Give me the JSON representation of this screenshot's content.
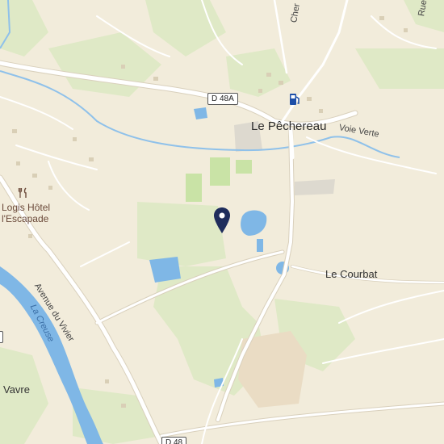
{
  "map": {
    "colors": {
      "land": "#f2ecdb",
      "green": "#dfe9c6",
      "water": "#7fb7e6",
      "road": "#ffffff",
      "road_edge": "#d9d0bc",
      "marker": "#1f2d5c",
      "fuel": "#1d4fa8"
    },
    "labels": {
      "town_pechereau": "Le Pêchereau",
      "courbat": "Le Courbat",
      "vavre": "Vavre",
      "voie_verte": "Voie Verte",
      "avenue_vivier": "Avenue du Vivier",
      "la_creuse": "La Creuse",
      "poi_line1": "Logis Hôtel",
      "poi_line2": "l'Escapade",
      "cher_partial": "Cher",
      "rue_partial": "Rue"
    },
    "road_shields": {
      "d48a": "D 48A",
      "d48": "D 48"
    },
    "icons": {
      "marker": "location-pin-icon",
      "fuel": "fuel-station-icon",
      "restaurant": "restaurant-icon"
    }
  }
}
